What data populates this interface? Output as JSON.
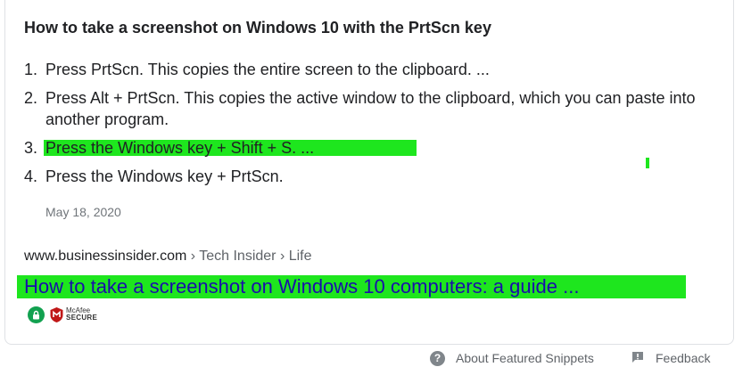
{
  "snippet": {
    "title": "How to take a screenshot on Windows 10 with the PrtScn key",
    "steps": [
      {
        "num": "1.",
        "text": "Press PrtScn. This copies the entire screen to the clipboard. ..."
      },
      {
        "num": "2.",
        "text": "Press Alt + PrtScn. This copies the active window to the clipboard, which you can paste into another program."
      },
      {
        "num": "3.",
        "text": "Press the Windows key + Shift + S. ..."
      },
      {
        "num": "4.",
        "text": "Press the Windows key + PrtScn."
      }
    ],
    "date": "May 18, 2020"
  },
  "source": {
    "domain": "www.businessinsider.com",
    "breadcrumb": " › Tech Insider › Life",
    "link_text": "How to take a screenshot on Windows 10 computers: a guide ...",
    "badge_brand": "McAfee",
    "badge_secure": "SECURE"
  },
  "footer": {
    "about_label": "About Featured Snippets",
    "feedback_label": "Feedback"
  },
  "colors": {
    "highlight": "#1ee61e",
    "link": "#1a0dab",
    "badge_green": "#12a150",
    "mcafee_red": "#c01818"
  },
  "icons": [
    "lock-icon",
    "mcafee-shield-icon",
    "help-icon",
    "feedback-icon"
  ]
}
